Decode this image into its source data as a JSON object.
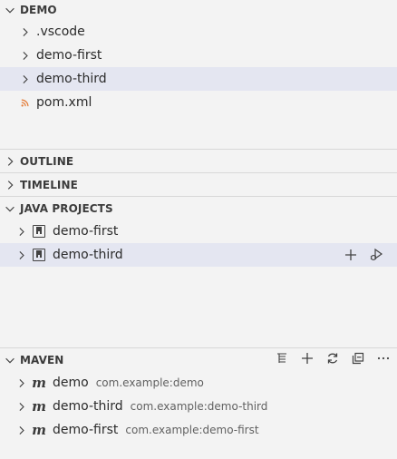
{
  "explorer": {
    "title": "DEMO",
    "items": [
      {
        "label": ".vscode"
      },
      {
        "label": "demo-first"
      },
      {
        "label": "demo-third"
      },
      {
        "label": "pom.xml"
      }
    ]
  },
  "outline": {
    "title": "OUTLINE"
  },
  "timeline": {
    "title": "TIMELINE"
  },
  "java_projects": {
    "title": "JAVA PROJECTS",
    "items": [
      {
        "label": "demo-first"
      },
      {
        "label": "demo-third"
      }
    ]
  },
  "maven": {
    "title": "MAVEN",
    "items": [
      {
        "label": "demo",
        "desc": "com.example:demo"
      },
      {
        "label": "demo-third",
        "desc": "com.example:demo-third"
      },
      {
        "label": "demo-first",
        "desc": "com.example:demo-first"
      }
    ]
  },
  "colors": {
    "selection": "#e4e6f1",
    "rss_orange": "#e37933",
    "background": "#f3f3f3"
  },
  "icons": {
    "twisty": "chevron-right-icon",
    "expanded": "chevron-down-icon",
    "pom": "rss-icon",
    "project": "project-icon",
    "maven": "maven-m-icon"
  }
}
